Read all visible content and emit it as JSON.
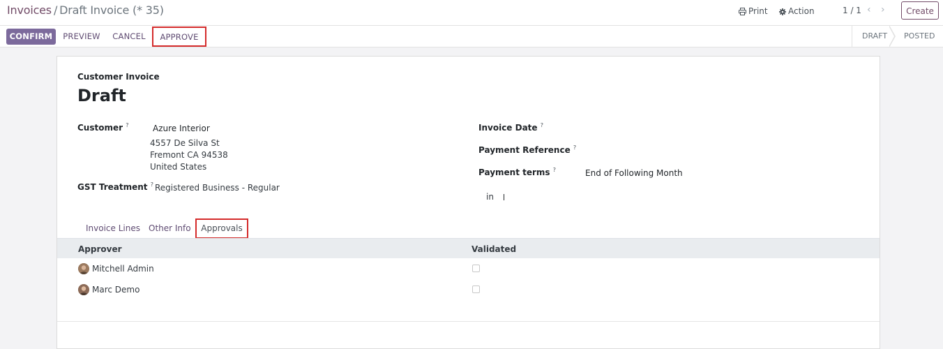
{
  "breadcrumb": {
    "parent": "Invoices",
    "separator": "/",
    "current": "Draft Invoice (* 35)"
  },
  "toolbar": {
    "print": "Print",
    "action": "Action",
    "pager": "1 / 1",
    "create": "Create"
  },
  "icons": {
    "print": "printer-icon",
    "action": "gear-icon",
    "prev": "chevron-left-icon",
    "next": "chevron-right-icon"
  },
  "statusbar": {
    "confirm": "CONFIRM",
    "preview": "PREVIEW",
    "cancel": "CANCEL",
    "approve": "APPROVE",
    "stages": [
      "DRAFT",
      "POSTED"
    ]
  },
  "form": {
    "move_type": "Customer Invoice",
    "state": "Draft",
    "customer_label": "Customer",
    "customer_name": "Azure Interior",
    "address": [
      "4557 De Silva St",
      "Fremont CA 94538",
      "United States"
    ],
    "gst_label": "GST Treatment",
    "gst_value": "Registered Business - Regular",
    "invoice_date_label": "Invoice Date",
    "payment_ref_label": "Payment Reference",
    "payment_terms_label": "Payment terms",
    "payment_terms_value": "End of Following Month",
    "currency_in": "in",
    "help_mark": "?"
  },
  "tabs": [
    "Invoice Lines",
    "Other Info",
    "Approvals"
  ],
  "approvals": {
    "columns": [
      "Approver",
      "Validated"
    ],
    "rows": [
      {
        "name": "Mitchell Admin",
        "validated": false
      },
      {
        "name": "Marc Demo",
        "validated": false
      }
    ]
  },
  "colors": {
    "brand": "#714b67",
    "confirm_bg": "#7c6a9c",
    "highlight": "#d42a2a"
  }
}
